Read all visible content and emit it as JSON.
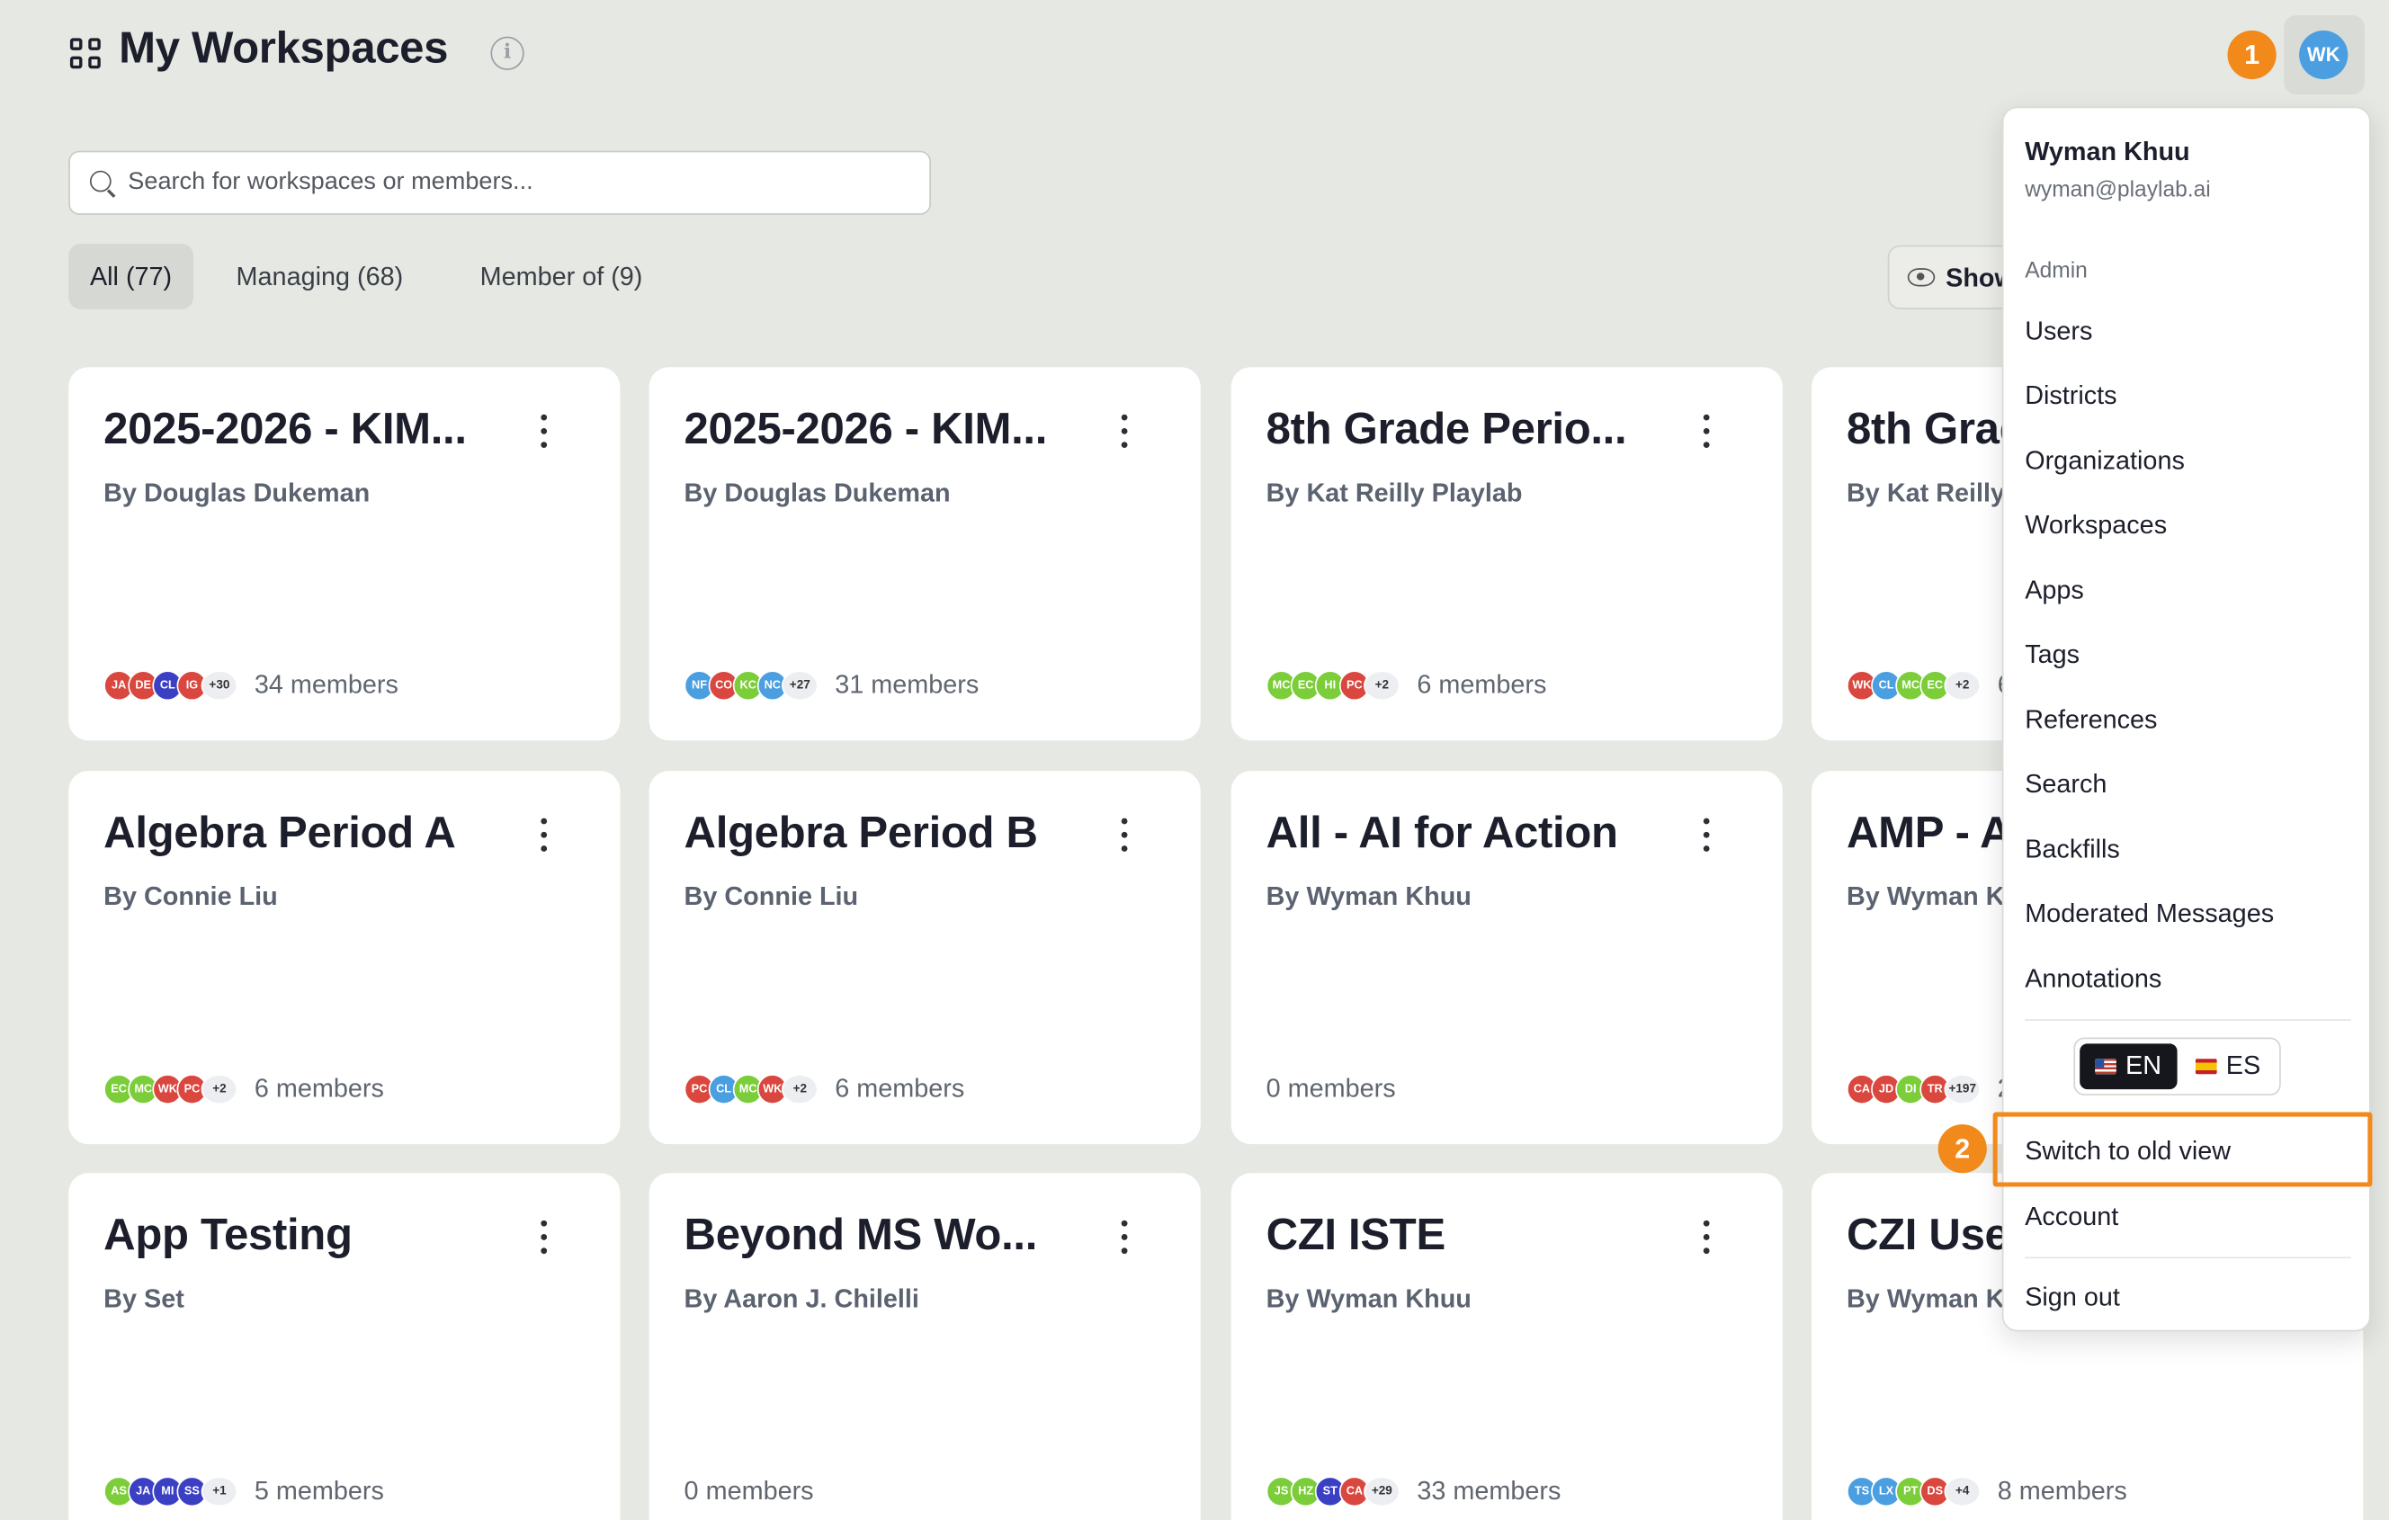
{
  "header": {
    "title": "My Workspaces",
    "info_icon": "i",
    "search_placeholder": "Search for workspaces or members...",
    "tabs": [
      {
        "label": "All (77)",
        "active": true
      },
      {
        "label": "Managing (68)",
        "active": false
      },
      {
        "label": "Member of (9)",
        "active": false
      }
    ],
    "show_button_label": "Show",
    "step_badges": [
      "1",
      "2"
    ],
    "user_initials": "WK"
  },
  "workspaces": [
    {
      "title": "2025-2026 - KIM...",
      "by": "By Douglas Dukeman",
      "avatars": [
        {
          "i": "JA",
          "c": "#d9473f"
        },
        {
          "i": "DE",
          "c": "#d9473f"
        },
        {
          "i": "CL",
          "c": "#3b3fc4"
        },
        {
          "i": "IG",
          "c": "#d9473f"
        }
      ],
      "extra": "+30",
      "members": "34 members"
    },
    {
      "title": "2025-2026 - KIM...",
      "by": "By Douglas Dukeman",
      "avatars": [
        {
          "i": "NF",
          "c": "#4b9fe0"
        },
        {
          "i": "CO",
          "c": "#d9473f"
        },
        {
          "i": "KC",
          "c": "#7ccd3a"
        },
        {
          "i": "NC",
          "c": "#4b9fe0"
        }
      ],
      "extra": "+27",
      "members": "31 members"
    },
    {
      "title": "8th Grade Perio...",
      "by": "By Kat Reilly Playlab",
      "avatars": [
        {
          "i": "MC",
          "c": "#7ccd3a"
        },
        {
          "i": "EC",
          "c": "#7ccd3a"
        },
        {
          "i": "HI",
          "c": "#7ccd3a"
        },
        {
          "i": "PC",
          "c": "#d9473f"
        }
      ],
      "extra": "+2",
      "members": "6 members"
    },
    {
      "title": "8th Grade Perio...",
      "by": "By Kat Reilly Playlab",
      "avatars": [
        {
          "i": "WK",
          "c": "#d9473f"
        },
        {
          "i": "CL",
          "c": "#4b9fe0"
        },
        {
          "i": "MC",
          "c": "#7ccd3a"
        },
        {
          "i": "EC",
          "c": "#7ccd3a"
        }
      ],
      "extra": "+2",
      "members": "6 members"
    },
    {
      "title": "Algebra Period A",
      "by": "By Connie Liu",
      "avatars": [
        {
          "i": "EC",
          "c": "#7ccd3a"
        },
        {
          "i": "MC",
          "c": "#7ccd3a"
        },
        {
          "i": "WK",
          "c": "#d9473f"
        },
        {
          "i": "PC",
          "c": "#d9473f"
        }
      ],
      "extra": "+2",
      "members": "6 members"
    },
    {
      "title": "Algebra Period B",
      "by": "By Connie Liu",
      "avatars": [
        {
          "i": "PC",
          "c": "#d9473f"
        },
        {
          "i": "CL",
          "c": "#4b9fe0"
        },
        {
          "i": "MC",
          "c": "#7ccd3a"
        },
        {
          "i": "WK",
          "c": "#d9473f"
        }
      ],
      "extra": "+2",
      "members": "6 members"
    },
    {
      "title": "All - AI for Action",
      "by": "By Wyman Khuu",
      "avatars": [],
      "extra": "",
      "members": "0 members"
    },
    {
      "title": "AMP - AI...",
      "by": "By Wyman Khuu",
      "avatars": [
        {
          "i": "CA",
          "c": "#d9473f"
        },
        {
          "i": "JD",
          "c": "#d9473f"
        },
        {
          "i": "DI",
          "c": "#7ccd3a"
        },
        {
          "i": "TR",
          "c": "#d9473f"
        }
      ],
      "extra": "+197",
      "members": "201 members"
    },
    {
      "title": "App Testing",
      "by": "By Set",
      "avatars": [
        {
          "i": "AS",
          "c": "#7ccd3a"
        },
        {
          "i": "JA",
          "c": "#3b3fc4"
        },
        {
          "i": "MI",
          "c": "#3b3fc4"
        },
        {
          "i": "SS",
          "c": "#3b3fc4"
        }
      ],
      "extra": "+1",
      "members": "5 members"
    },
    {
      "title": "Beyond MS Wo...",
      "by": "By Aaron J. Chilelli",
      "avatars": [],
      "extra": "",
      "members": "0 members"
    },
    {
      "title": "CZI ISTE",
      "by": "By Wyman Khuu",
      "avatars": [
        {
          "i": "JS",
          "c": "#7ccd3a"
        },
        {
          "i": "HZ",
          "c": "#7ccd3a"
        },
        {
          "i": "ST",
          "c": "#3b3fc4"
        },
        {
          "i": "CA",
          "c": "#d9473f"
        }
      ],
      "extra": "+29",
      "members": "33 members"
    },
    {
      "title": "CZI User...",
      "by": "By Wyman Khuu",
      "avatars": [
        {
          "i": "TS",
          "c": "#4b9fe0"
        },
        {
          "i": "LX",
          "c": "#4b9fe0"
        },
        {
          "i": "PT",
          "c": "#7ccd3a"
        },
        {
          "i": "DS",
          "c": "#d9473f"
        }
      ],
      "extra": "+4",
      "members": "8 members"
    }
  ],
  "user_menu": {
    "name": "Wyman Khuu",
    "email": "wyman@playlab.ai",
    "section": "Admin",
    "admin_items": [
      "Users",
      "Districts",
      "Organizations",
      "Workspaces",
      "Apps",
      "Tags",
      "References",
      "Search",
      "Backfills",
      "Moderated Messages",
      "Annotations"
    ],
    "languages": [
      "EN",
      "ES"
    ],
    "switch_view": "Switch to old view",
    "account": "Account",
    "sign_out": "Sign out"
  },
  "colors": {
    "background": "#e6e8e3",
    "accent_orange": "#f28a1b",
    "avatar_blue": "#4b9fe0"
  }
}
